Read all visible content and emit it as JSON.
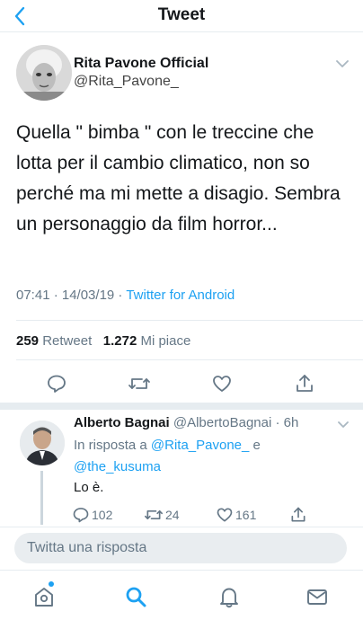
{
  "header": {
    "title": "Tweet",
    "back_icon": "chevron-left-icon"
  },
  "tweet": {
    "author_name": "Rita Pavone Official",
    "author_handle": "@Rita_Pavone_",
    "text": "Quella \" bimba \" con le treccine che lotta per il cambio climatico, non so perché  ma mi mette a disagio. Sembra un personaggio da film horror...",
    "time": "07:41 · 14/03/19 · ",
    "source": "Twitter for Android",
    "retweet_count": "259",
    "retweet_label": "Retweet",
    "like_count": "1.272",
    "like_label": "Mi piace"
  },
  "reply": {
    "author_name": "Alberto Bagnai",
    "author_handle": "@AlbertoBagnai",
    "time": "· 6h",
    "in_reply_prefix": "In risposta a ",
    "mention_1": "@Rita_Pavone_",
    "conjunction": " e ",
    "mention_2": "@the_kusuma",
    "text": "Lo è.",
    "reply_count": "102",
    "retweet_count": "24",
    "like_count": "161"
  },
  "compose": {
    "placeholder": "Twitta una risposta"
  },
  "tabbar": {
    "items": [
      "home-icon",
      "search-icon",
      "notifications-icon",
      "messages-icon"
    ],
    "active": "search-icon"
  },
  "colors": {
    "accent": "#1da1f2",
    "muted": "#657786",
    "text": "#14171a",
    "divider": "#e6ecf0"
  }
}
